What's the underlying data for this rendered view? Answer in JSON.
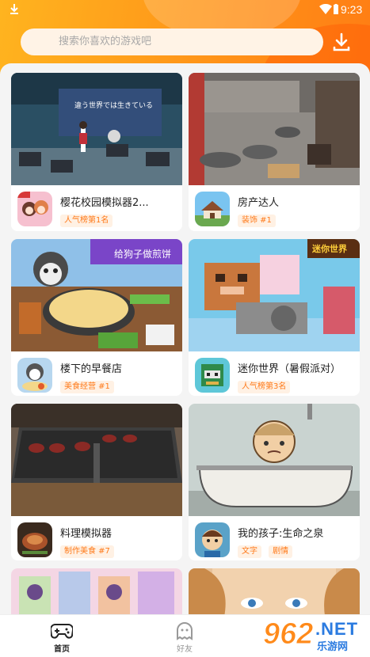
{
  "status_bar": {
    "time": "9:23"
  },
  "search": {
    "placeholder": "搜索你喜欢的游戏吧"
  },
  "games": [
    {
      "title": "樱花校园模拟器2...",
      "tags": [
        "人气榜第1名"
      ]
    },
    {
      "title": "房产达人",
      "tags": [
        "装饰 #1"
      ]
    },
    {
      "title": "楼下的早餐店",
      "tags": [
        "美食经营 #1"
      ]
    },
    {
      "title": "迷你世界（暑假派对）",
      "tags": [
        "人气榜第3名"
      ]
    },
    {
      "title": "料理模拟器",
      "tags": [
        "制作美食 #7"
      ]
    },
    {
      "title": "我的孩子:生命之泉",
      "tags": [
        "文字",
        "剧情"
      ]
    }
  ],
  "covers": {
    "c1_banner": "違う世界では生きている",
    "c3_banner": "给狗子做煎饼",
    "c4_logo": "迷你世界"
  },
  "nav": {
    "home": "首页",
    "friends": "好友"
  },
  "watermark": {
    "num": "962",
    "site": ".NET",
    "sub": "乐游网"
  },
  "colors": {
    "accent": "#ff7a1a",
    "header_start": "#ffb41f",
    "header_end": "#ff7d14"
  }
}
